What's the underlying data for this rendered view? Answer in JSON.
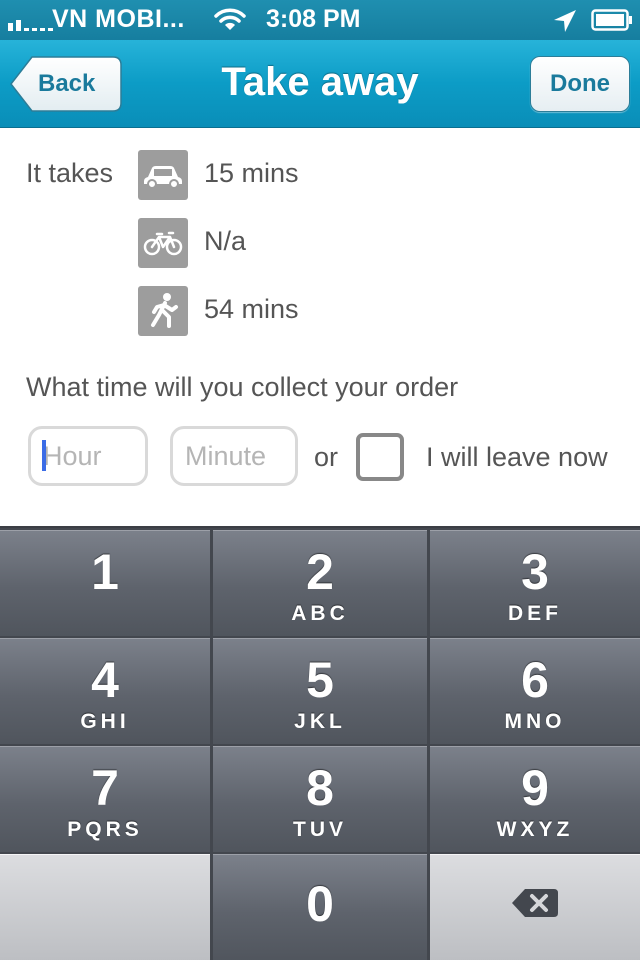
{
  "status_bar": {
    "carrier": "VN MOBI...",
    "time": "3:08 PM",
    "icons": [
      "signal-bars-icon",
      "wifi-icon",
      "location-arrow-icon",
      "battery-icon"
    ]
  },
  "nav": {
    "back_label": "Back",
    "title": "Take away",
    "done_label": "Done"
  },
  "travel": {
    "label": "It takes",
    "modes": [
      {
        "icon": "car-icon",
        "value": "15 mins"
      },
      {
        "icon": "bicycle-icon",
        "value": "N/a"
      },
      {
        "icon": "walking-icon",
        "value": "54 mins"
      }
    ]
  },
  "collect": {
    "question": "What time will you collect your order",
    "hour_placeholder": "Hour",
    "minute_placeholder": "Minute",
    "or_label": "or",
    "leave_now_label": "I will leave now",
    "leave_now_checked": false
  },
  "keypad": {
    "keys": [
      {
        "digit": "1",
        "letters": ""
      },
      {
        "digit": "2",
        "letters": "ABC"
      },
      {
        "digit": "3",
        "letters": "DEF"
      },
      {
        "digit": "4",
        "letters": "GHI"
      },
      {
        "digit": "5",
        "letters": "JKL"
      },
      {
        "digit": "6",
        "letters": "MNO"
      },
      {
        "digit": "7",
        "letters": "PQRS"
      },
      {
        "digit": "8",
        "letters": "TUV"
      },
      {
        "digit": "9",
        "letters": "WXYZ"
      },
      {
        "digit": "0",
        "letters": ""
      }
    ],
    "delete_icon": "backspace-icon"
  },
  "colors": {
    "nav_bar": "#0c9cc6",
    "status_bar": "#1f8fb0",
    "button_text": "#1a7a9c",
    "icon_tile": "#9d9d9d",
    "cursor": "#3b6ce6",
    "keypad_key": "#5e636c"
  }
}
